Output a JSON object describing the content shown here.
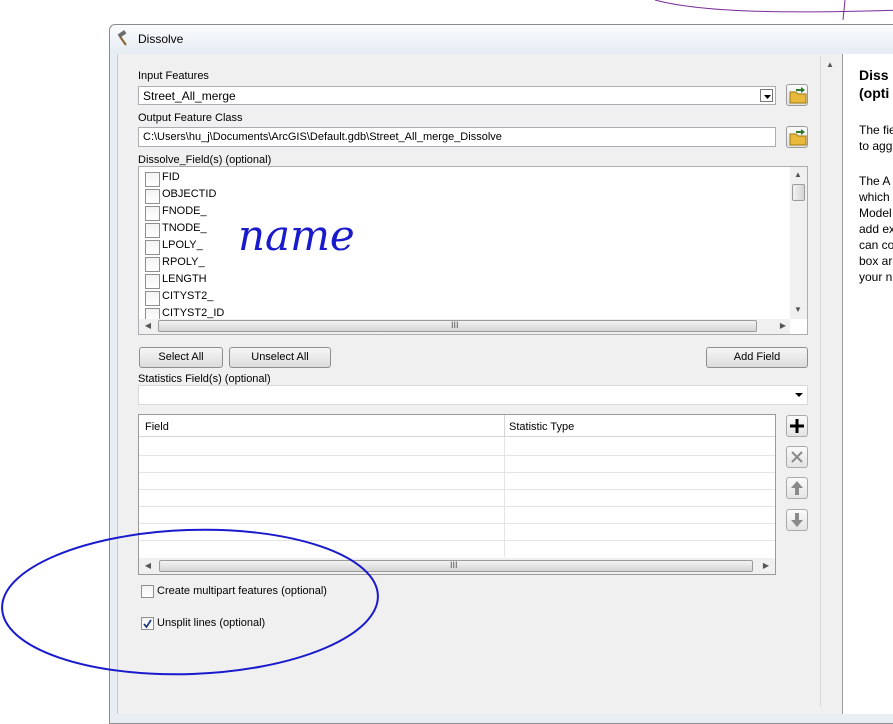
{
  "window": {
    "title": "Dissolve"
  },
  "input_features": {
    "label": "Input Features",
    "value": "Street_All_merge"
  },
  "output_feature_class": {
    "label": "Output Feature Class",
    "value": "C:\\Users\\hu_j\\Documents\\ArcGIS\\Default.gdb\\Street_All_merge_Dissolve"
  },
  "dissolve_fields": {
    "label": "Dissolve_Field(s) (optional)",
    "items": [
      {
        "label": "FID",
        "checked": false
      },
      {
        "label": "OBJECTID",
        "checked": false
      },
      {
        "label": "FNODE_",
        "checked": false
      },
      {
        "label": "TNODE_",
        "checked": false
      },
      {
        "label": "LPOLY_",
        "checked": false
      },
      {
        "label": "RPOLY_",
        "checked": false
      },
      {
        "label": "LENGTH",
        "checked": false
      },
      {
        "label": "CITYST2_",
        "checked": false
      },
      {
        "label": "CITYST2_ID",
        "checked": false
      }
    ]
  },
  "buttons": {
    "select_all": "Select All",
    "unselect_all": "Unselect All",
    "add_field": "Add Field"
  },
  "statistics": {
    "label": "Statistics Field(s) (optional)",
    "value": "",
    "columns": [
      "Field",
      "Statistic Type"
    ]
  },
  "options": {
    "multipart": {
      "label": "Create multipart features (optional)",
      "checked": false
    },
    "unsplit": {
      "label": "Unsplit lines (optional)",
      "checked": true
    }
  },
  "help": {
    "title_lines": [
      "Diss",
      "(opti"
    ],
    "para1": [
      "The fie",
      "to agg"
    ],
    "para2": [
      "The A",
      "which",
      "Model",
      "add ex",
      "can co",
      "box ar",
      "your n"
    ]
  },
  "annotations": {
    "handwritten_text": "name",
    "ink_color": "#1a1acd"
  },
  "scrollbar_grip": "III",
  "icons": [
    "hammer-icon",
    "folder-icon",
    "plus-icon",
    "delete-icon",
    "arrow-up-icon",
    "arrow-down-icon",
    "chevron-down-icon"
  ]
}
